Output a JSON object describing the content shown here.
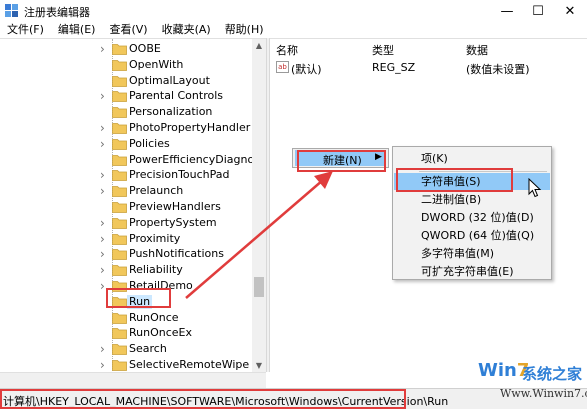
{
  "window": {
    "title": "注册表编辑器",
    "minimize_glyph": "—",
    "maximize_glyph": "☐",
    "close_glyph": "✕"
  },
  "menubar": {
    "items": [
      {
        "label": "文件(F)"
      },
      {
        "label": "编辑(E)"
      },
      {
        "label": "查看(V)"
      },
      {
        "label": "收藏夹(A)"
      },
      {
        "label": "帮助(H)"
      }
    ]
  },
  "tree": {
    "items": [
      {
        "label": "OOBE",
        "has_children": true
      },
      {
        "label": "OpenWith",
        "has_children": false
      },
      {
        "label": "OptimalLayout",
        "has_children": false
      },
      {
        "label": "Parental Controls",
        "has_children": true
      },
      {
        "label": "Personalization",
        "has_children": false
      },
      {
        "label": "PhotoPropertyHandler",
        "has_children": true
      },
      {
        "label": "Policies",
        "has_children": true
      },
      {
        "label": "PowerEfficiencyDiagnostics",
        "has_children": false
      },
      {
        "label": "PrecisionTouchPad",
        "has_children": true
      },
      {
        "label": "Prelaunch",
        "has_children": true
      },
      {
        "label": "PreviewHandlers",
        "has_children": false
      },
      {
        "label": "PropertySystem",
        "has_children": true
      },
      {
        "label": "Proximity",
        "has_children": true
      },
      {
        "label": "PushNotifications",
        "has_children": true
      },
      {
        "label": "Reliability",
        "has_children": true
      },
      {
        "label": "RetailDemo",
        "has_children": true
      },
      {
        "label": "Run",
        "has_children": false,
        "selected": true
      },
      {
        "label": "RunOnce",
        "has_children": false
      },
      {
        "label": "RunOnceEx",
        "has_children": false
      },
      {
        "label": "Search",
        "has_children": true
      },
      {
        "label": "SelectiveRemoteWipe",
        "has_children": true
      }
    ]
  },
  "list": {
    "columns": {
      "name": "名称",
      "type": "类型",
      "data": "数据"
    },
    "rows": [
      {
        "icon": "ab",
        "name": "(默认)",
        "type": "REG_SZ",
        "data": "(数值未设置)"
      }
    ]
  },
  "context_menu": {
    "new_label": "新建(N)",
    "new_arrow": "▶",
    "submenu": [
      {
        "label": "项(K)"
      },
      {
        "label": "字符串值(S)",
        "hover": true
      },
      {
        "label": "二进制值(B)"
      },
      {
        "label": "DWORD (32 位)值(D)"
      },
      {
        "label": "QWORD (64 位)值(Q)"
      },
      {
        "label": "多字符串值(M)"
      },
      {
        "label": "可扩充字符串值(E)"
      }
    ]
  },
  "statusbar": {
    "path": "计算机\\HKEY_LOCAL_MACHINE\\SOFTWARE\\Microsoft\\Windows\\CurrentVersion\\Run"
  },
  "watermark": {
    "logo_prefix": "Win",
    "logo_seven": "7",
    "logo_cn": "系统之家",
    "url": "Www.Winwin7.com"
  },
  "colors": {
    "annotation_red": "#e03c3c",
    "menu_hover": "#91c9f7",
    "folder_yellow": "#f1c75b"
  },
  "icons": {
    "app": "regedit-icon",
    "folder": "folder-icon",
    "string_value": "ab-string-value-icon"
  }
}
